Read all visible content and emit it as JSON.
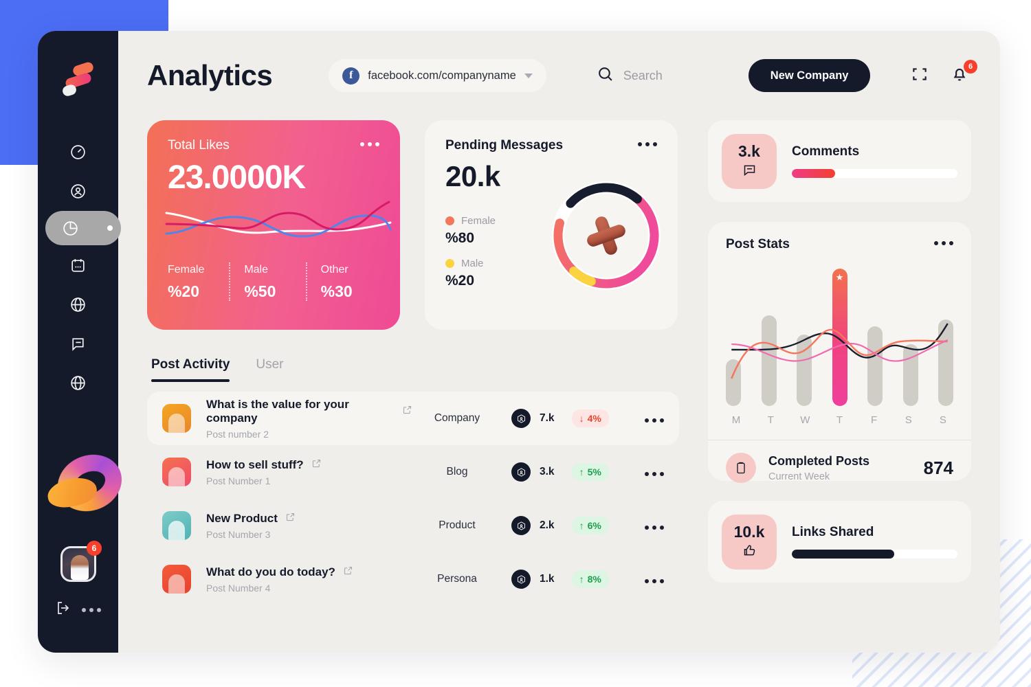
{
  "header": {
    "title": "Analytics",
    "url_chip": {
      "icon": "facebook-icon",
      "text": "facebook.com/companyname"
    },
    "search_placeholder": "Search",
    "new_company_label": "New Company",
    "notification_count": "6"
  },
  "sidebar": {
    "items": [
      {
        "name": "dashboard-icon",
        "label": "Dashboard",
        "active": false
      },
      {
        "name": "profile-icon",
        "label": "Profile",
        "active": false
      },
      {
        "name": "analytics-icon",
        "label": "Analytics",
        "active": true
      },
      {
        "name": "calendar-icon",
        "label": "Calendar",
        "active": false
      },
      {
        "name": "globe-icon",
        "label": "Network",
        "active": false
      },
      {
        "name": "message-icon",
        "label": "Messages",
        "active": false
      },
      {
        "name": "globe-alt-icon",
        "label": "Global",
        "active": false
      }
    ],
    "avatar_badge": "6"
  },
  "total_likes": {
    "title": "Total Likes",
    "value": "23.0000K",
    "stats": [
      {
        "label": "Female",
        "value": "%20"
      },
      {
        "label": "Male",
        "value": "%50"
      },
      {
        "label": "Other",
        "value": "%30"
      }
    ]
  },
  "pending_messages": {
    "title": "Pending Messages",
    "value": "20.k",
    "legend": [
      {
        "label": "Female",
        "value": "%80",
        "color": "#f4765c"
      },
      {
        "label": "Male",
        "value": "%20",
        "color": "#fbd341"
      }
    ]
  },
  "tabs": [
    {
      "label": "Post Activity",
      "active": true
    },
    {
      "label": "User",
      "active": false
    }
  ],
  "posts": [
    {
      "title": "What is the value for your company",
      "sub": "Post number 2",
      "category": "Company",
      "views": "7.k",
      "change": "4%",
      "trend": "down"
    },
    {
      "title": "How to sell stuff?",
      "sub": "Post Number 1",
      "category": "Blog",
      "views": "3.k",
      "change": "5%",
      "trend": "up"
    },
    {
      "title": "New Product",
      "sub": "Post Number 3",
      "category": "Product",
      "views": "2.k",
      "change": "6%",
      "trend": "up"
    },
    {
      "title": "What do you do today?",
      "sub": "Post Number 4",
      "category": "Persona",
      "views": "1.k",
      "change": "8%",
      "trend": "up"
    }
  ],
  "comments_card": {
    "value": "3.k",
    "label": "Comments",
    "progress": 26,
    "icon": "message-icon"
  },
  "post_stats": {
    "title": "Post Stats"
  },
  "completed_posts": {
    "title": "Completed Posts",
    "sub": "Current Week",
    "value": "874",
    "icon": "clipboard-icon"
  },
  "links_shared": {
    "value": "10.k",
    "label": "Links Shared",
    "progress": 62,
    "icon": "thumbs-up-icon"
  },
  "colors": {
    "accent_pink": "#ef4a95",
    "accent_orange": "#f37055",
    "dark": "#151a2b",
    "app_bg": "#efeeea",
    "card_bg": "#f6f5f2",
    "up": "#1f9d4e",
    "down": "#e8452f",
    "badge_red": "#f6402c",
    "blue_deco": "#4c6ef5"
  },
  "chart_data": {
    "type": "bar",
    "title": "Post Stats",
    "categories": [
      "M",
      "T",
      "W",
      "T",
      "F",
      "S",
      "S"
    ],
    "values": [
      34,
      66,
      52,
      100,
      58,
      45,
      63
    ],
    "highlight_index": 3,
    "highlight_marker": "star",
    "ylim": [
      0,
      100
    ],
    "grid": false,
    "xlabel": "",
    "ylabel": "",
    "series": [
      {
        "name": "bars",
        "values": [
          34,
          66,
          52,
          100,
          58,
          45,
          63
        ]
      },
      {
        "name": "trend-dark",
        "values": [
          40,
          40,
          42,
          55,
          52,
          35,
          42,
          62
        ]
      },
      {
        "name": "trend-orange",
        "values": [
          22,
          48,
          40,
          58,
          44,
          36,
          52,
          52
        ]
      },
      {
        "name": "trend-pink",
        "values": [
          44,
          36,
          30,
          34,
          44,
          34,
          32,
          46
        ]
      }
    ]
  }
}
